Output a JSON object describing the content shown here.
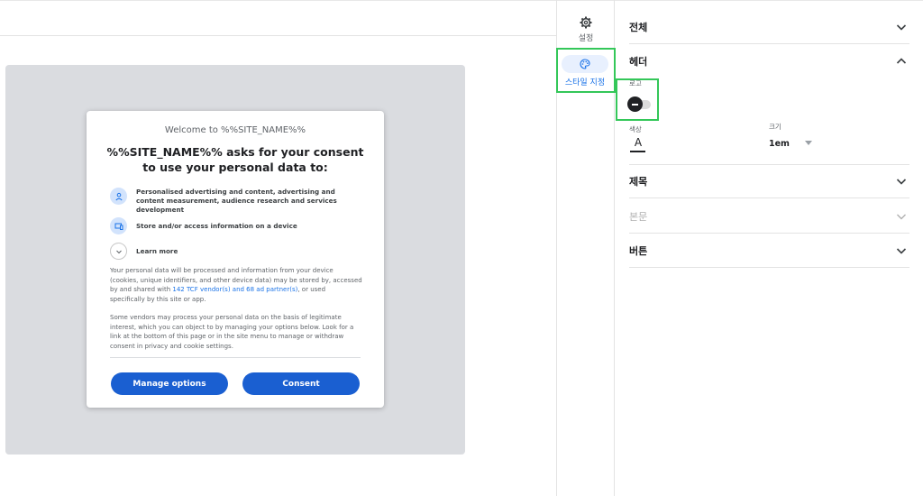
{
  "preview": {
    "welcome": "Welcome to %%SITE_NAME%%",
    "headline": "%%SITE_NAME%% asks for your consent to use your personal data to:",
    "purposes": [
      {
        "icon": "person-icon",
        "text": "Personalised advertising and content, advertising and content measurement, audience research and services development"
      },
      {
        "icon": "device-icon",
        "text": "Store and/or access information on a device"
      }
    ],
    "learn_more": "Learn more",
    "para1_before": "Your personal data will be processed and information from your device (cookies, unique identifiers, and other device data) may be stored by, accessed by and shared with ",
    "para1_link": "142 TCF vendor(s) and 68 ad partner(s)",
    "para1_after": ", or used specifically by this site or app.",
    "para2": "Some vendors may process your personal data on the basis of legitimate interest, which you can object to by managing your options below. Look for a link at the bottom of this page or in the site menu to manage or withdraw consent in privacy and cookie settings.",
    "manage_button": "Manage options",
    "consent_button": "Consent"
  },
  "tabs": {
    "settings_label": "설정",
    "style_label": "스타일 지정",
    "settings_icon": "gear-icon",
    "style_icon": "palette-icon"
  },
  "panel": {
    "all": "전체",
    "header": "헤더",
    "logo_label": "로고",
    "color_label": "색상",
    "size_label": "크기",
    "size_value": "1em",
    "title": "제목",
    "body": "본문",
    "buttons": "버튼"
  },
  "colors": {
    "accent": "#1a73e8",
    "button": "#1a5fd1",
    "highlight": "#34c759",
    "preview_bg": "#dadce0"
  }
}
